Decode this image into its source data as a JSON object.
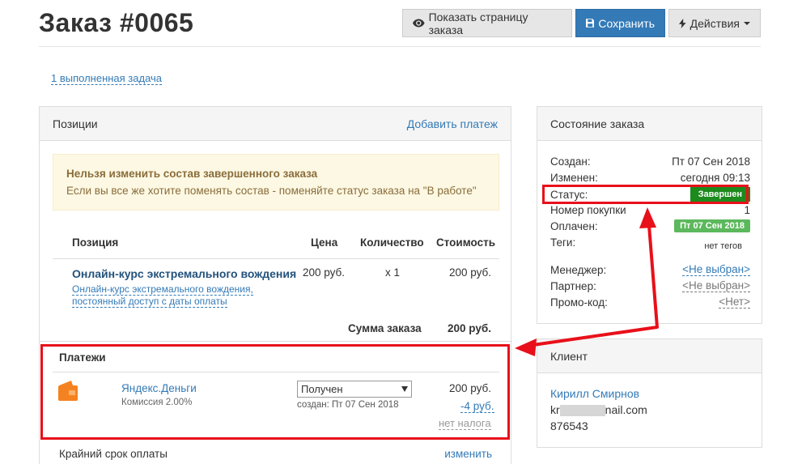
{
  "header": {
    "title": "Заказ #0065",
    "view_button": "Показать страницу заказа",
    "save_button": "Сохранить",
    "actions_button": "Действия"
  },
  "tasks_link": "1 выполненная задача",
  "positions": {
    "title": "Позиции",
    "add_payment": "Добавить платеж",
    "warning_title": "Нельзя изменить состав завершенного заказа",
    "warning_text": "Если вы все же хотите поменять состав - поменяйте статус заказа на \"В работе\"",
    "columns": [
      "Позиция",
      "Цена",
      "Количество",
      "Стоимость"
    ],
    "item": {
      "name": "Онлайн-курс экстремального вождения",
      "desc_line1": "Онлайн-курс экстремального вождения,",
      "desc_line2": "постоянный доступ с даты оплаты",
      "price": "200 руб.",
      "qty": "x 1",
      "cost": "200 руб."
    },
    "total_label": "Сумма заказа",
    "total_value": "200 руб."
  },
  "payments": {
    "title": "Платежи",
    "method": "Яндекс.Деньги",
    "fee": "Комиссия 2.00%",
    "status": "Получен",
    "created": "создан: Пт 07 Сен 2018",
    "amount": "200 руб.",
    "commission": "-4 руб.",
    "tax": "нет налога"
  },
  "deadline": {
    "label": "Крайний срок оплаты",
    "change": "изменить"
  },
  "state": {
    "title": "Состояние заказа",
    "created_label": "Создан:",
    "created_value": "Пт 07 Сен 2018",
    "changed_label": "Изменен:",
    "changed_value": "сегодня 09:13",
    "status_label": "Статус:",
    "status_value": "Завершен",
    "purchase_label": "Номер покупки",
    "purchase_value": "1",
    "paid_label": "Оплачен:",
    "paid_value": "Пт 07 Сен 2018",
    "tags_label": "Теги:",
    "tags_value": "нет тегов",
    "manager_label": "Менеджер:",
    "manager_value": "<Не выбран>",
    "partner_label": "Партнер:",
    "partner_value": "<Не выбран>",
    "promo_label": "Промо-код:",
    "promo_value": "<Нет>"
  },
  "client": {
    "title": "Клиент",
    "name": "Кирилл Смирнов",
    "email_start": "kr",
    "email_end": "nail.com",
    "phone": "876543"
  },
  "colors": {
    "primary": "#337ab7",
    "success_dark": "#1c8a1c",
    "success": "#5cb85c",
    "annotation_red": "#e8101a",
    "yandex_orange": "#f58220"
  }
}
